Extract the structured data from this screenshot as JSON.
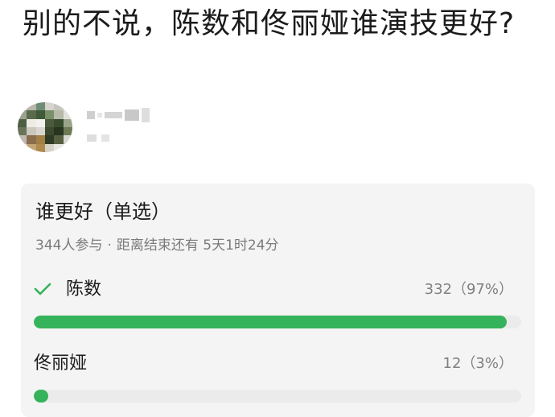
{
  "question": {
    "title": "别的不说，陈数和佟丽娅谁演技更好?"
  },
  "poll": {
    "title": "谁更好（单选）",
    "participants": "344人参与",
    "separator": "·",
    "deadline": "距离结束还有 5天1时24分",
    "options": [
      {
        "label": "陈数",
        "count_text": "332（97%）",
        "votes": 332,
        "percent": 97,
        "selected": true
      },
      {
        "label": "佟丽娅",
        "count_text": "12（3%）",
        "votes": 12,
        "percent": 3,
        "selected": false
      }
    ]
  },
  "colors": {
    "accent_green": "#35b35a",
    "card_background": "#f4f4f4",
    "track": "#ebebeb",
    "muted_text": "#7b7b7b"
  },
  "icons": {
    "selected_marker": "check-icon"
  }
}
